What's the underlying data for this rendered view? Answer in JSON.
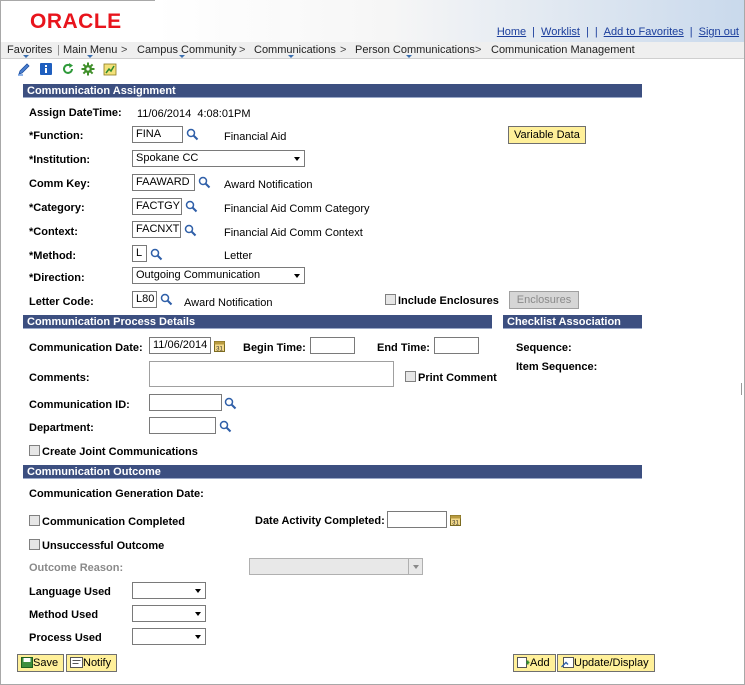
{
  "branding": {
    "logo": "ORACLE"
  },
  "header_links": {
    "home": "Home",
    "worklist": "Worklist",
    "add_to_favorites": "Add to Favorites",
    "sign_out": "Sign out"
  },
  "breadcrumb": {
    "favorites": "Favorites",
    "main_menu": "Main Menu",
    "campus_community": "Campus Community",
    "communications": "Communications",
    "person_communications": "Person Communications",
    "communication_management": "Communication Management",
    "separator": ">"
  },
  "toolbar_icons": [
    "edit-pencil-icon",
    "info-icon",
    "refresh-icon",
    "settings-gear-icon",
    "chart-icon"
  ],
  "colors": {
    "section_bar": "#3c4f80",
    "button": "#fff09a",
    "link": "#1b3e9c",
    "logo": "#e8141c"
  },
  "assignment": {
    "section_title": "Communication Assignment",
    "assign_datetime_label": "Assign DateTime:",
    "assign_datetime_value": "11/06/2014  4:08:01PM",
    "function_label": "*Function:",
    "function_value": "FINA",
    "function_desc": "Financial Aid",
    "variable_data_button": "Variable Data",
    "institution_label": "*Institution:",
    "institution_value": "Spokane CC",
    "comm_key_label": "Comm Key:",
    "comm_key_value": "FAAWARD",
    "comm_key_desc": "Award Notification",
    "category_label": "*Category:",
    "category_value": "FACTGY",
    "category_desc": "Financial Aid Comm Category",
    "context_label": "*Context:",
    "context_value": "FACNXT",
    "context_desc": "Financial Aid Comm Context",
    "method_label": "*Method:",
    "method_value": "L",
    "method_desc": "Letter",
    "direction_label": "*Direction:",
    "direction_value": "Outgoing Communication",
    "letter_code_label": "Letter Code:",
    "letter_code_value": "L80",
    "letter_code_desc": "Award Notification",
    "include_enclosures_label": "Include Enclosures",
    "enclosures_button": "Enclosures"
  },
  "process": {
    "section_title": "Communication Process Details",
    "comm_date_label": "Communication Date:",
    "comm_date_value": "11/06/2014",
    "begin_time_label": "Begin Time:",
    "begin_time_value": "",
    "end_time_label": "End Time:",
    "end_time_value": "",
    "comments_label": "Comments:",
    "print_comment_label": "Print Comment",
    "comm_id_label": "Communication ID:",
    "comm_id_value": "",
    "department_label": "Department:",
    "department_value": "",
    "create_joint_label": "Create Joint Communications"
  },
  "checklist": {
    "section_title": "Checklist Association",
    "sequence_label": "Sequence:",
    "item_sequence_label": "Item Sequence:"
  },
  "outcome": {
    "section_title": "Communication Outcome",
    "generation_date_label": "Communication Generation Date:",
    "completed_label": "Communication Completed",
    "date_activity_label": "Date Activity Completed:",
    "date_activity_value": "",
    "unsuccessful_label": "Unsuccessful Outcome",
    "outcome_reason_label": "Outcome Reason:",
    "outcome_reason_value": "",
    "language_used_label": "Language Used",
    "language_used_value": "",
    "method_used_label": "Method Used",
    "method_used_value": "",
    "process_used_label": "Process Used",
    "process_used_value": ""
  },
  "footer": {
    "save": "Save",
    "notify": "Notify",
    "add": "Add",
    "update_display": "Update/Display"
  }
}
